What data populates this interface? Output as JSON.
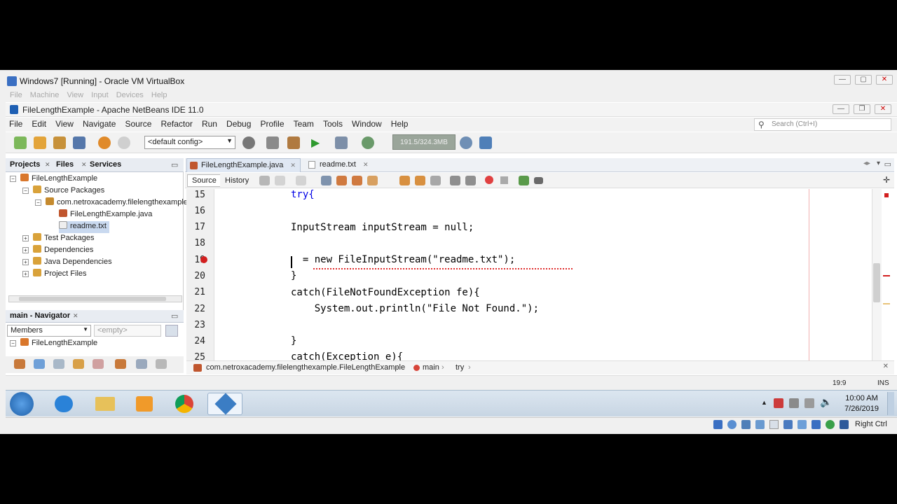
{
  "vbox": {
    "title": "Windows7 [Running] - Oracle VM VirtualBox",
    "menu": [
      "File",
      "Machine",
      "View",
      "Input",
      "Devices",
      "Help"
    ],
    "host_key": "Right Ctrl"
  },
  "netbeans": {
    "title": "FileLengthExample - Apache NetBeans IDE 11.0",
    "menu": [
      "File",
      "Edit",
      "View",
      "Navigate",
      "Source",
      "Refactor",
      "Run",
      "Debug",
      "Profile",
      "Team",
      "Tools",
      "Window",
      "Help"
    ],
    "search_placeholder": "Search (Ctrl+I)",
    "config": "<default config>",
    "memory": "191.5/324.3MB"
  },
  "projects_panel": {
    "tabs": [
      "Projects",
      "Files",
      "Services"
    ],
    "tree": [
      {
        "label": "FileLengthExample",
        "depth": 0
      },
      {
        "label": "Source Packages",
        "depth": 1
      },
      {
        "label": "com.netroxacademy.filelengthexample",
        "depth": 2
      },
      {
        "label": "FileLengthExample.java",
        "depth": 3
      },
      {
        "label": "readme.txt",
        "depth": 3
      },
      {
        "label": "Test Packages",
        "depth": 1
      },
      {
        "label": "Dependencies",
        "depth": 1
      },
      {
        "label": "Java Dependencies",
        "depth": 1
      },
      {
        "label": "Project Files",
        "depth": 1
      }
    ]
  },
  "navigator": {
    "title": "main - Navigator",
    "members": "Members",
    "filter": "<empty>",
    "root": "FileLengthExample"
  },
  "editor": {
    "tabs": [
      "FileLengthExample.java",
      "readme.txt"
    ],
    "subtabs": [
      "Source",
      "History"
    ],
    "lines": [
      {
        "n": "15",
        "text": "try{"
      },
      {
        "n": "16",
        "text": ""
      },
      {
        "n": "17",
        "text": "InputStream inputStream = null;"
      },
      {
        "n": "18",
        "text": ""
      },
      {
        "n": "19",
        "text": "  = new FileInputStream(\"readme.txt\");"
      },
      {
        "n": "20",
        "text": "}"
      },
      {
        "n": "21",
        "text": "catch(FileNotFoundException fe){"
      },
      {
        "n": "22",
        "text": "    System.out.println(\"File Not Found.\");"
      },
      {
        "n": "23",
        "text": ""
      },
      {
        "n": "24",
        "text": "}"
      },
      {
        "n": "25",
        "text": "catch(Exception e){"
      }
    ],
    "breadcrumbs": [
      "com.netroxacademy.filelengthexample.FileLengthExample",
      "main",
      "try"
    ]
  },
  "status": {
    "position": "19:9",
    "mode": "INS"
  },
  "taskbar": {
    "time": "10:00 AM",
    "date": "7/26/2019"
  }
}
